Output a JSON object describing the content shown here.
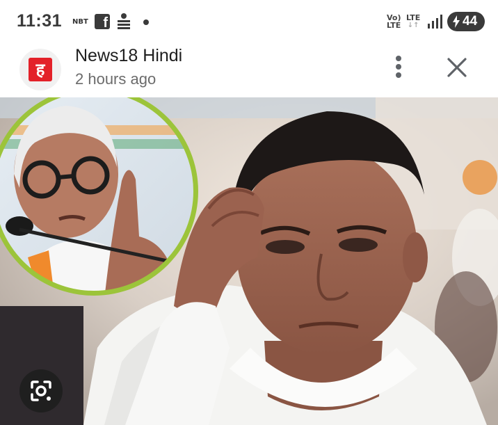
{
  "status_bar": {
    "time": "11:31",
    "nbt_label": "NBT",
    "volte_label_top": "Vo)",
    "volte_label_bottom": "LTE",
    "lte_label": "LTE",
    "battery_level": "44",
    "icons": [
      "nbt-icon",
      "facebook-icon",
      "bhaskar-icon",
      "notification-dot-icon",
      "volte-icon",
      "lte-icon",
      "signal-icon",
      "battery-charging-icon"
    ]
  },
  "header": {
    "logo_letter": "ह",
    "logo_color": "#e32129",
    "source_name": "News18 Hindi",
    "time_ago": "2 hours ago",
    "more_icon": "more-vertical-icon",
    "close_icon": "close-icon"
  },
  "image": {
    "inset_photo": "inset-portrait-circle",
    "main_photo": "main-portrait",
    "inset_border_color": "#9cc43a",
    "lens_icon": "google-lens-icon"
  }
}
